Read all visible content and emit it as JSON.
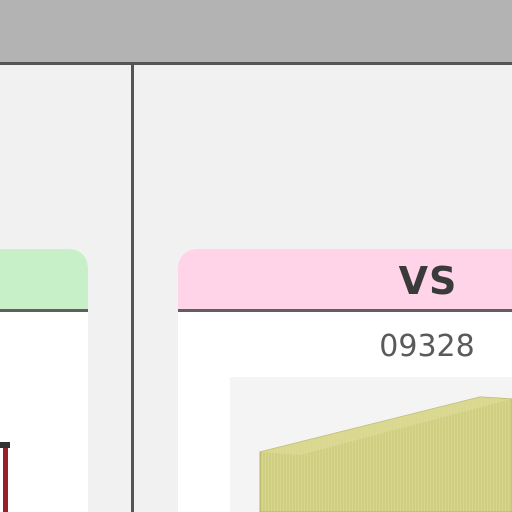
{
  "colors": {
    "topbar": "#b3b3b3",
    "divider": "#555555",
    "left_card_header": "#c8f0c8",
    "right_card_header": "#ffd4e8",
    "product_box": "#d9d98a"
  },
  "right_card": {
    "title": "VS",
    "code": "09328",
    "image_icon": "tan-box-icon"
  },
  "left_card": {
    "image_icon": "red-frame-icon"
  }
}
